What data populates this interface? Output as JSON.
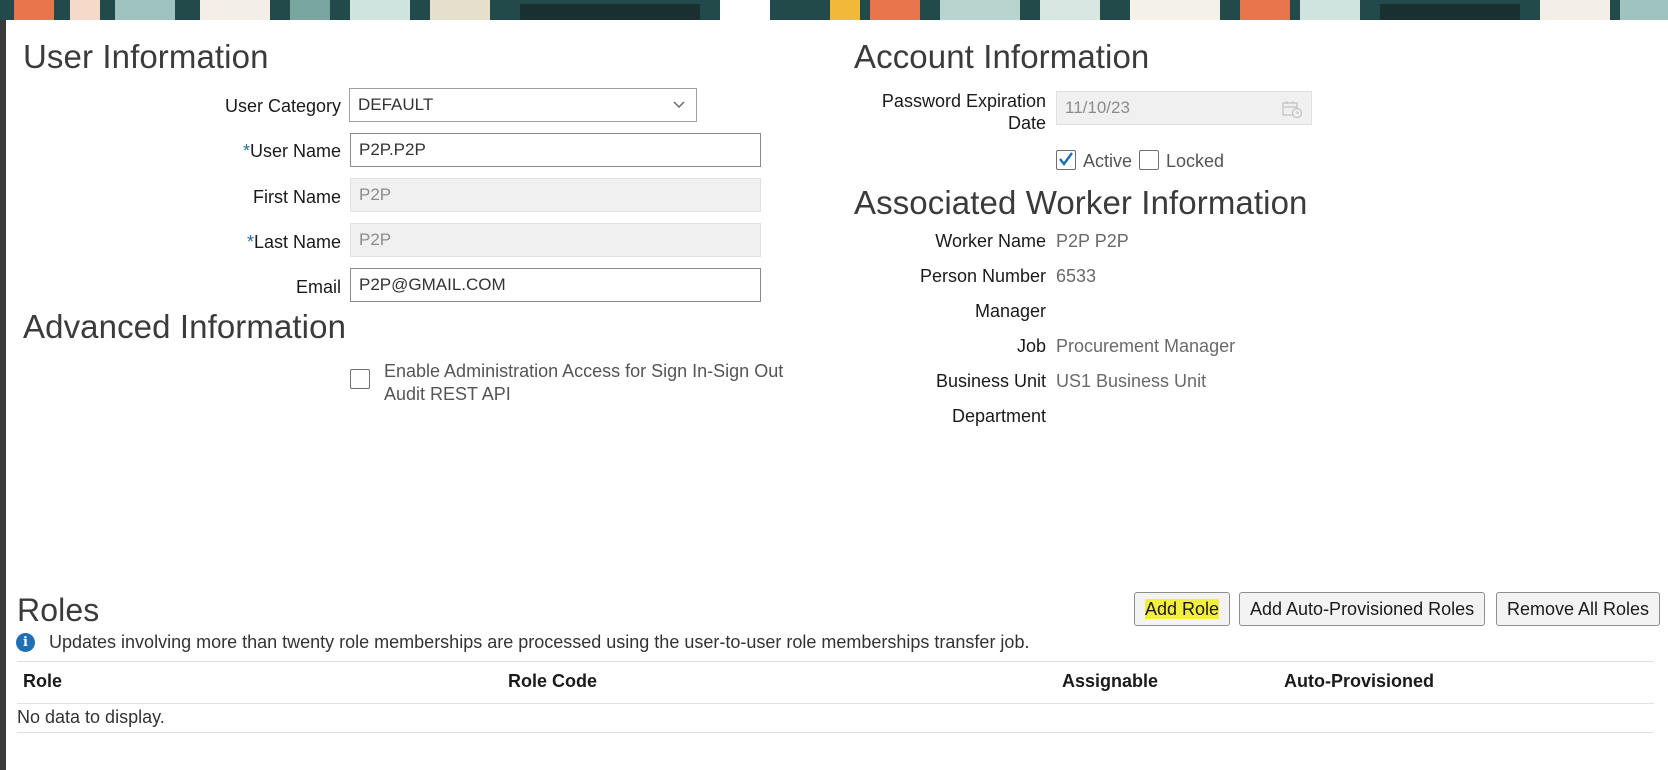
{
  "user_info": {
    "heading": "User Information",
    "user_category": {
      "label": "User Category",
      "value": "DEFAULT"
    },
    "user_name": {
      "label": "User Name",
      "required_mark": "*",
      "value": "P2P.P2P"
    },
    "first_name": {
      "label": "First Name",
      "value": "P2P"
    },
    "last_name": {
      "label": "Last Name",
      "required_mark": "*",
      "value": "P2P"
    },
    "email": {
      "label": "Email",
      "value": "P2P@GMAIL.COM"
    }
  },
  "advanced_info": {
    "heading": "Advanced Information",
    "admin_access": {
      "label_line1": "Enable Administration Access for Sign In-Sign Out",
      "label_line2": "Audit REST API",
      "checked": false
    }
  },
  "account_info": {
    "heading": "Account Information",
    "password_expiration": {
      "label_line1": "Password Expiration",
      "label_line2": "Date",
      "value": "11/10/23"
    },
    "active": {
      "label": "Active",
      "checked": true
    },
    "locked": {
      "label": "Locked",
      "checked": false
    }
  },
  "worker_info": {
    "heading": "Associated Worker Information",
    "fields": [
      {
        "label": "Worker Name",
        "value": "P2P P2P"
      },
      {
        "label": "Person Number",
        "value": "6533"
      },
      {
        "label": "Manager",
        "value": ""
      },
      {
        "label": "Job",
        "value": "Procurement Manager"
      },
      {
        "label": "Business Unit",
        "value": "US1 Business Unit"
      },
      {
        "label": "Department",
        "value": ""
      }
    ]
  },
  "roles": {
    "heading": "Roles",
    "buttons": {
      "add_role": "Add Role",
      "add_auto": "Add Auto-Provisioned Roles",
      "remove_all": "Remove All Roles"
    },
    "info_message": "Updates involving more than twenty role memberships are processed using the user-to-user role memberships transfer job.",
    "info_icon_glyph": "i",
    "columns": [
      "Role",
      "Role Code",
      "Assignable",
      "Auto-Provisioned"
    ],
    "empty_message": "No data to display."
  },
  "colors": {
    "highlight": "#f4ef3a",
    "info_icon": "#1f6fb5",
    "required_mark": "#2b6ca3",
    "check": "#1f6fb5"
  }
}
